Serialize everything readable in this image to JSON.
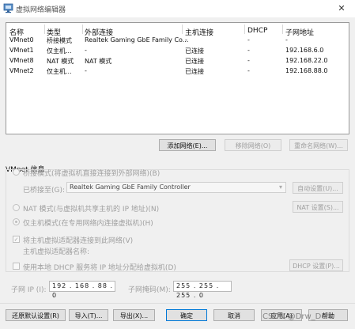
{
  "window": {
    "title": "虚拟网络编辑器",
    "close": "✕"
  },
  "table": {
    "headers": {
      "name": "名称",
      "type": "类型",
      "external": "外部连接",
      "host": "主机连接",
      "dhcp": "DHCP",
      "subnet": "子网地址"
    },
    "rows": [
      {
        "name": "VMnet0",
        "type": "桥接模式",
        "external": "Realtek Gaming GbE Family Co...",
        "host": "-",
        "dhcp": "-",
        "subnet": "-"
      },
      {
        "name": "VMnet1",
        "type": "仅主机...",
        "external": "-",
        "host": "已连接",
        "dhcp": "-",
        "subnet": "192.168.6.0"
      },
      {
        "name": "VMnet8",
        "type": "NAT 模式",
        "external": "NAT 模式",
        "host": "已连接",
        "dhcp": "-",
        "subnet": "192.168.22.0"
      },
      {
        "name": "VMnet2",
        "type": "仅主机...",
        "external": "-",
        "host": "已连接",
        "dhcp": "-",
        "subnet": "192.168.88.0"
      }
    ]
  },
  "net_buttons": {
    "add": "添加网络(E)...",
    "remove": "移除网络(O)",
    "rename": "重命名网络(W)..."
  },
  "vmnet_info": {
    "title": "VMnet 信息",
    "bridge_label": "桥接模式(将虚拟机直接连接到外部网络)(B)",
    "bridged_to_label": "已桥接至(G):",
    "bridged_to_value": "Realtek Gaming GbE Family Controller",
    "auto_settings": "自动设置(U)...",
    "nat_label": "NAT 模式(与虚拟机共享主机的 IP 地址)(N)",
    "nat_settings": "NAT 设置(S)...",
    "host_only_label": "仅主机模式(在专用网络内连接虚拟机)(H)",
    "connect_adapter_label": "将主机虚拟适配器连接到此网络(V)",
    "adapter_name_label": "主机虚拟适配器名称:",
    "dhcp_label": "使用本地 DHCP 服务将 IP 地址分配给虚拟机(D)",
    "dhcp_settings": "DHCP 设置(P)...",
    "subnet_ip_label": "子网 IP (I):",
    "subnet_ip_value": "192 . 168 . 88 . 0",
    "subnet_mask_label": "子网掩码(M):",
    "subnet_mask_value": "255 . 255 . 255 . 0",
    "check_mark": "✓"
  },
  "footer": {
    "restore": "还原默认设置(R)",
    "import": "导入(T)...",
    "export": "导出(X)...",
    "ok": "确定",
    "cancel": "取消",
    "apply": "应用(A)",
    "help": "帮助"
  },
  "watermark": "CSDN @Drw_Dcm"
}
